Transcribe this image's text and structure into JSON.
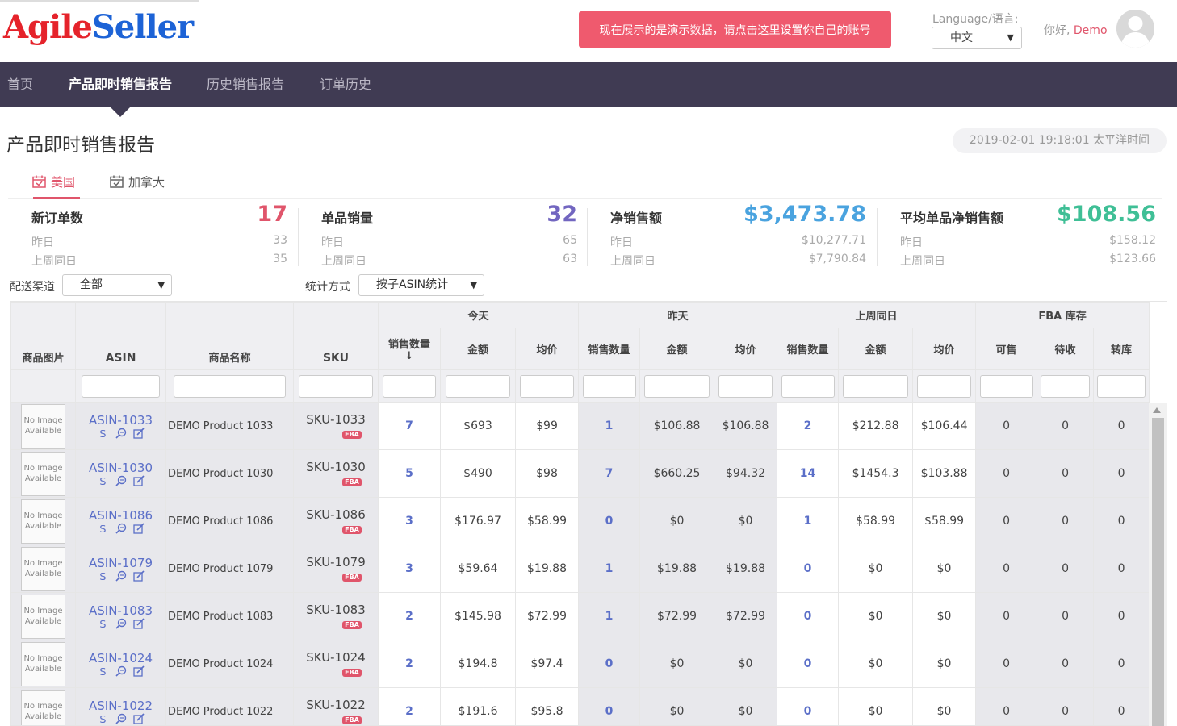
{
  "header": {
    "logo_part1": "Agile",
    "logo_part2": "Seller",
    "demo_notice": "现在展示的是演示数据，请点击这里设置你自己的账号",
    "language_label": "Language/语言:",
    "language_value": "中文",
    "greeting": "你好,",
    "username": "Demo"
  },
  "nav": {
    "items": [
      {
        "label": "首页",
        "active": false
      },
      {
        "label": "产品即时销售报告",
        "active": true
      },
      {
        "label": "历史销售报告",
        "active": false
      },
      {
        "label": "订单历史",
        "active": false
      }
    ]
  },
  "page": {
    "title": "产品即时销售报告",
    "datetime": "2019-02-01 19:18:01 太平洋时间"
  },
  "country_tabs": [
    {
      "label": "美国",
      "active": true
    },
    {
      "label": "加拿大",
      "active": false
    }
  ],
  "stats": [
    {
      "label": "新订单数",
      "value": "17",
      "color": "#e0556b",
      "yesterday_label": "昨日",
      "yesterday": "33",
      "lastweek_label": "上周同日",
      "lastweek": "35"
    },
    {
      "label": "单品销量",
      "value": "32",
      "color": "#7266c0",
      "yesterday_label": "昨日",
      "yesterday": "65",
      "lastweek_label": "上周同日",
      "lastweek": "63"
    },
    {
      "label": "净销售额",
      "value": "$3,473.78",
      "color": "#4aa3df",
      "yesterday_label": "昨日",
      "yesterday": "$10,277.71",
      "lastweek_label": "上周同日",
      "lastweek": "$7,790.84"
    },
    {
      "label": "平均单品净销售额",
      "value": "$108.56",
      "color": "#3fbf96",
      "yesterday_label": "昨日",
      "yesterday": "$158.12",
      "lastweek_label": "上周同日",
      "lastweek": "$123.66"
    }
  ],
  "filters": {
    "channel_label": "配送渠道",
    "channel_value": "全部",
    "stat_label": "统计方式",
    "stat_value": "按子ASIN统计"
  },
  "table": {
    "groups": {
      "today": "今天",
      "yesterday": "昨天",
      "lastweek": "上周同日",
      "fba": "FBA 库存"
    },
    "columns": {
      "image": "商品图片",
      "asin": "ASIN",
      "name": "商品名称",
      "sku": "SKU",
      "qty": "销售数量",
      "amount": "金额",
      "avg": "均价",
      "sellable": "可售",
      "inbound": "待收",
      "transfer": "转库"
    },
    "sort_arrow": "↓",
    "no_image": [
      "No Image",
      "Available"
    ],
    "fba_badge": "FBA",
    "rows": [
      {
        "asin": "ASIN-1033",
        "name": "DEMO Product 1033",
        "sku": "SKU-1033",
        "t_qty": "7",
        "t_amt": "$693",
        "t_avg": "$99",
        "y_qty": "1",
        "y_amt": "$106.88",
        "y_avg": "$106.88",
        "w_qty": "2",
        "w_amt": "$212.88",
        "w_avg": "$106.44",
        "sell": "0",
        "inb": "0",
        "trans": "0"
      },
      {
        "asin": "ASIN-1030",
        "name": "DEMO Product 1030",
        "sku": "SKU-1030",
        "t_qty": "5",
        "t_amt": "$490",
        "t_avg": "$98",
        "y_qty": "7",
        "y_amt": "$660.25",
        "y_avg": "$94.32",
        "w_qty": "14",
        "w_amt": "$1454.3",
        "w_avg": "$103.88",
        "sell": "0",
        "inb": "0",
        "trans": "0"
      },
      {
        "asin": "ASIN-1086",
        "name": "DEMO Product 1086",
        "sku": "SKU-1086",
        "t_qty": "3",
        "t_amt": "$176.97",
        "t_avg": "$58.99",
        "y_qty": "0",
        "y_amt": "$0",
        "y_avg": "$0",
        "w_qty": "1",
        "w_amt": "$58.99",
        "w_avg": "$58.99",
        "sell": "0",
        "inb": "0",
        "trans": "0"
      },
      {
        "asin": "ASIN-1079",
        "name": "DEMO Product 1079",
        "sku": "SKU-1079",
        "t_qty": "3",
        "t_amt": "$59.64",
        "t_avg": "$19.88",
        "y_qty": "1",
        "y_amt": "$19.88",
        "y_avg": "$19.88",
        "w_qty": "0",
        "w_amt": "$0",
        "w_avg": "$0",
        "sell": "0",
        "inb": "0",
        "trans": "0"
      },
      {
        "asin": "ASIN-1083",
        "name": "DEMO Product 1083",
        "sku": "SKU-1083",
        "t_qty": "2",
        "t_amt": "$145.98",
        "t_avg": "$72.99",
        "y_qty": "1",
        "y_amt": "$72.99",
        "y_avg": "$72.99",
        "w_qty": "0",
        "w_amt": "$0",
        "w_avg": "$0",
        "sell": "0",
        "inb": "0",
        "trans": "0"
      },
      {
        "asin": "ASIN-1024",
        "name": "DEMO Product 1024",
        "sku": "SKU-1024",
        "t_qty": "2",
        "t_amt": "$194.8",
        "t_avg": "$97.4",
        "y_qty": "0",
        "y_amt": "$0",
        "y_avg": "$0",
        "w_qty": "0",
        "w_amt": "$0",
        "w_avg": "$0",
        "sell": "0",
        "inb": "0",
        "trans": "0"
      },
      {
        "asin": "ASIN-1022",
        "name": "DEMO Product 1022",
        "sku": "SKU-1022",
        "t_qty": "2",
        "t_amt": "$191.6",
        "t_avg": "$95.8",
        "y_qty": "0",
        "y_amt": "$0",
        "y_avg": "$0",
        "w_qty": "0",
        "w_amt": "$0",
        "w_avg": "$0",
        "sell": "0",
        "inb": "0",
        "trans": "0"
      }
    ]
  }
}
